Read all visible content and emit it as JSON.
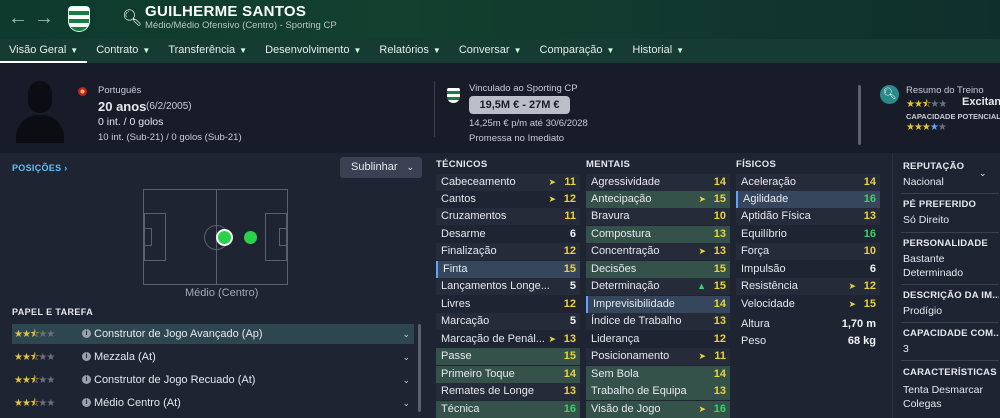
{
  "header": {
    "name": "GUILHERME SANTOS",
    "subtitle": "Médio/Médio Ofensivo (Centro) - Sporting CP",
    "back_icon": "←",
    "fwd_icon": "→"
  },
  "menu": [
    {
      "label": "Visão Geral",
      "active": true
    },
    {
      "label": "Contrato"
    },
    {
      "label": "Transferência"
    },
    {
      "label": "Desenvolvimento"
    },
    {
      "label": "Relatórios"
    },
    {
      "label": "Conversar"
    },
    {
      "label": "Comparação"
    },
    {
      "label": "Historial"
    }
  ],
  "info": {
    "nationality": "Português",
    "age": "20 anos",
    "dob": "(6/2/2005)",
    "intl": "0 int. / 0 golos",
    "intl_u21": "10 int. (Sub-21) / 0 golos (Sub-21)",
    "contract_label": "Vinculado ao Sporting CP",
    "value": "19,5M € - 27M €",
    "wage": "14,25m € p/m até 30/6/2028",
    "promise": "Promessa no Imediato",
    "training_label": "Resumo do Treino",
    "training_status": "Excitant",
    "potential_label": "CAPACIDADE POTENCIAL"
  },
  "positions": {
    "title": "POSIÇÕES",
    "highlight_btn": "Sublinhar",
    "pos_label": "Médio (Centro)"
  },
  "roles": {
    "title": "PAPEL E TAREFA",
    "items": [
      {
        "label": "Construtor de Jogo Avançado (Ap)"
      },
      {
        "label": "Mezzala (At)"
      },
      {
        "label": "Construtor de Jogo Recuado (At)"
      },
      {
        "label": "Médio Centro (At)"
      }
    ]
  },
  "attributes": {
    "tech_title": "TÉCNICOS",
    "mental_title": "MENTAIS",
    "phys_title": "FÍSICOS",
    "technical": [
      {
        "n": "Cabeceamento",
        "v": "11"
      },
      {
        "n": "Cantos",
        "v": "12"
      },
      {
        "n": "Cruzamentos",
        "v": "11"
      },
      {
        "n": "Desarme",
        "v": "6"
      },
      {
        "n": "Finalização",
        "v": "12"
      },
      {
        "n": "Finta",
        "v": "15"
      },
      {
        "n": "Lançamentos Longe...",
        "v": "5"
      },
      {
        "n": "Livres",
        "v": "12"
      },
      {
        "n": "Marcação",
        "v": "5"
      },
      {
        "n": "Marcação de Penál...",
        "v": "13"
      },
      {
        "n": "Passe",
        "v": "15"
      },
      {
        "n": "Primeiro Toque",
        "v": "14"
      },
      {
        "n": "Remates de Longe",
        "v": "13"
      },
      {
        "n": "Técnica",
        "v": "16"
      }
    ],
    "mental": [
      {
        "n": "Agressividade",
        "v": "14"
      },
      {
        "n": "Antecipação",
        "v": "15"
      },
      {
        "n": "Bravura",
        "v": "10"
      },
      {
        "n": "Compostura",
        "v": "13"
      },
      {
        "n": "Concentração",
        "v": "13"
      },
      {
        "n": "Decisões",
        "v": "15"
      },
      {
        "n": "Determinação",
        "v": "15"
      },
      {
        "n": "Imprevisibilidade",
        "v": "14"
      },
      {
        "n": "Índice de Trabalho",
        "v": "13"
      },
      {
        "n": "Liderança",
        "v": "12"
      },
      {
        "n": "Posicionamento",
        "v": "11"
      },
      {
        "n": "Sem Bola",
        "v": "14"
      },
      {
        "n": "Trabalho de Equipa",
        "v": "13"
      },
      {
        "n": "Visão de Jogo",
        "v": "16"
      }
    ],
    "physical": [
      {
        "n": "Aceleração",
        "v": "14"
      },
      {
        "n": "Agilidade",
        "v": "16"
      },
      {
        "n": "Aptidão Física",
        "v": "13"
      },
      {
        "n": "Equilíbrio",
        "v": "16"
      },
      {
        "n": "Força",
        "v": "10"
      },
      {
        "n": "Impulsão",
        "v": "6"
      },
      {
        "n": "Resistência",
        "v": "12"
      },
      {
        "n": "Velocidade",
        "v": "15"
      },
      {
        "n": "Altura",
        "v": "1,70 m"
      },
      {
        "n": "Peso",
        "v": "68 kg"
      }
    ]
  },
  "side": {
    "rep_h": "REPUTAÇÃO",
    "rep_v": "Nacional",
    "foot_h": "PÉ PREFERIDO",
    "foot_v": "Só Direito",
    "pers_h": "PERSONALIDADE",
    "pers_v1": "Bastante",
    "pers_v2": "Determinado",
    "media_h": "DESCRIÇÃO DA IM...",
    "media_v": "Prodígio",
    "cap_h": "CAPACIDADE COM...",
    "cap_v": "3",
    "char_h": "CARACTERÍSTICAS D",
    "char_v1": "Tenta Desmarcar",
    "char_v2": "Colegas"
  }
}
